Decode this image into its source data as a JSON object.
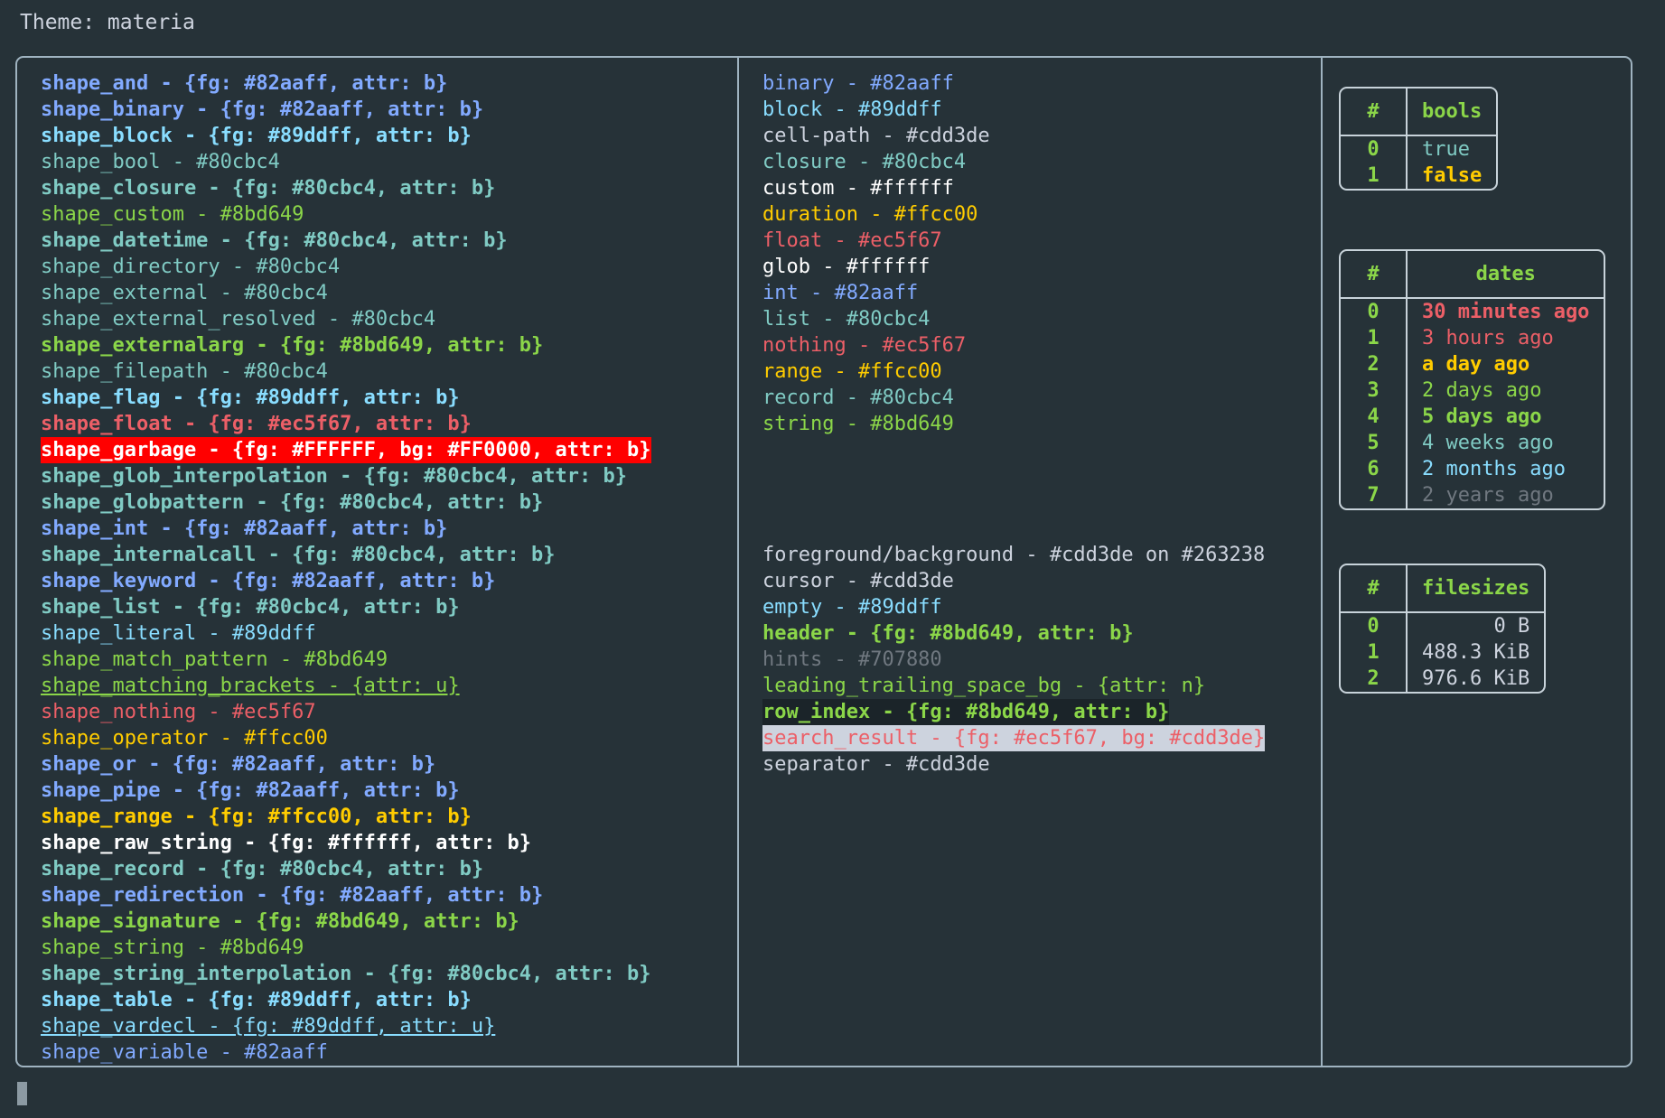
{
  "header": {
    "title": "Theme: materia"
  },
  "palette": {
    "blue": "#82aaff",
    "cyan": "#89ddff",
    "teal": "#80cbc4",
    "green": "#8bd649",
    "red": "#ec5f67",
    "yellow": "#ffcc00",
    "white": "#ffffff",
    "fg": "#cdd3de",
    "hint": "#707880",
    "bg": "#263238",
    "garbage_bg": "#ff0000",
    "garbage_fg": "#ffffff",
    "search_bg": "#cdd3de",
    "rowindex_bg": "#1b2429"
  },
  "shapes": [
    {
      "text": "shape_and - {fg: #82aaff, attr: b}",
      "color": "#82aaff",
      "bold": true
    },
    {
      "text": "shape_binary - {fg: #82aaff, attr: b}",
      "color": "#82aaff",
      "bold": true
    },
    {
      "text": "shape_block - {fg: #89ddff, attr: b}",
      "color": "#89ddff",
      "bold": true
    },
    {
      "text": "shape_bool - #80cbc4",
      "color": "#80cbc4",
      "bold": false
    },
    {
      "text": "shape_closure - {fg: #80cbc4, attr: b}",
      "color": "#80cbc4",
      "bold": true
    },
    {
      "text": "shape_custom - #8bd649",
      "color": "#8bd649",
      "bold": false
    },
    {
      "text": "shape_datetime - {fg: #80cbc4, attr: b}",
      "color": "#80cbc4",
      "bold": true
    },
    {
      "text": "shape_directory - #80cbc4",
      "color": "#80cbc4",
      "bold": false
    },
    {
      "text": "shape_external - #80cbc4",
      "color": "#80cbc4",
      "bold": false
    },
    {
      "text": "shape_external_resolved - #80cbc4",
      "color": "#80cbc4",
      "bold": false
    },
    {
      "text": "shape_externalarg - {fg: #8bd649, attr: b}",
      "color": "#8bd649",
      "bold": true
    },
    {
      "text": "shape_filepath - #80cbc4",
      "color": "#80cbc4",
      "bold": false
    },
    {
      "text": "shape_flag - {fg: #89ddff, attr: b}",
      "color": "#89ddff",
      "bold": true
    },
    {
      "text": "shape_float - {fg: #ec5f67, attr: b}",
      "color": "#ec5f67",
      "bold": true
    },
    {
      "text": "shape_garbage - {fg: #FFFFFF, bg: #FF0000, attr: b}",
      "color": "#ffffff",
      "bg": "#ff0000",
      "bold": true
    },
    {
      "text": "shape_glob_interpolation - {fg: #80cbc4, attr: b}",
      "color": "#80cbc4",
      "bold": true
    },
    {
      "text": "shape_globpattern - {fg: #80cbc4, attr: b}",
      "color": "#80cbc4",
      "bold": true
    },
    {
      "text": "shape_int - {fg: #82aaff, attr: b}",
      "color": "#82aaff",
      "bold": true
    },
    {
      "text": "shape_internalcall - {fg: #80cbc4, attr: b}",
      "color": "#80cbc4",
      "bold": true
    },
    {
      "text": "shape_keyword - {fg: #82aaff, attr: b}",
      "color": "#82aaff",
      "bold": true
    },
    {
      "text": "shape_list - {fg: #80cbc4, attr: b}",
      "color": "#80cbc4",
      "bold": true
    },
    {
      "text": "shape_literal - #89ddff",
      "color": "#89ddff",
      "bold": false
    },
    {
      "text": "shape_match_pattern - #8bd649",
      "color": "#8bd649",
      "bold": false
    },
    {
      "text": "shape_matching_brackets - {attr: u}",
      "color": "#8bd649",
      "bold": false,
      "underline": true
    },
    {
      "text": "shape_nothing - #ec5f67",
      "color": "#ec5f67",
      "bold": false
    },
    {
      "text": "shape_operator - #ffcc00",
      "color": "#ffcc00",
      "bold": false
    },
    {
      "text": "shape_or - {fg: #82aaff, attr: b}",
      "color": "#82aaff",
      "bold": true
    },
    {
      "text": "shape_pipe - {fg: #82aaff, attr: b}",
      "color": "#82aaff",
      "bold": true
    },
    {
      "text": "shape_range - {fg: #ffcc00, attr: b}",
      "color": "#ffcc00",
      "bold": true
    },
    {
      "text": "shape_raw_string - {fg: #ffffff, attr: b}",
      "color": "#ffffff",
      "bold": true
    },
    {
      "text": "shape_record - {fg: #80cbc4, attr: b}",
      "color": "#80cbc4",
      "bold": true
    },
    {
      "text": "shape_redirection - {fg: #82aaff, attr: b}",
      "color": "#82aaff",
      "bold": true
    },
    {
      "text": "shape_signature - {fg: #8bd649, attr: b}",
      "color": "#8bd649",
      "bold": true
    },
    {
      "text": "shape_string - #8bd649",
      "color": "#8bd649",
      "bold": false
    },
    {
      "text": "shape_string_interpolation - {fg: #80cbc4, attr: b}",
      "color": "#80cbc4",
      "bold": true
    },
    {
      "text": "shape_table - {fg: #89ddff, attr: b}",
      "color": "#89ddff",
      "bold": true
    },
    {
      "text": "shape_vardecl - {fg: #89ddff, attr: u}",
      "color": "#89ddff",
      "bold": false,
      "underline": true
    },
    {
      "text": "shape_variable - #82aaff",
      "color": "#82aaff",
      "bold": false
    }
  ],
  "types": [
    {
      "text": "binary - #82aaff",
      "color": "#82aaff",
      "bold": false
    },
    {
      "text": "block - #89ddff",
      "color": "#89ddff",
      "bold": false
    },
    {
      "text": "cell-path - #cdd3de",
      "color": "#cdd3de",
      "bold": false
    },
    {
      "text": "closure - #80cbc4",
      "color": "#80cbc4",
      "bold": false
    },
    {
      "text": "custom - #ffffff",
      "color": "#ffffff",
      "bold": false
    },
    {
      "text": "duration - #ffcc00",
      "color": "#ffcc00",
      "bold": false
    },
    {
      "text": "float - #ec5f67",
      "color": "#ec5f67",
      "bold": false
    },
    {
      "text": "glob - #ffffff",
      "color": "#ffffff",
      "bold": false
    },
    {
      "text": "int - #82aaff",
      "color": "#82aaff",
      "bold": false
    },
    {
      "text": "list - #80cbc4",
      "color": "#80cbc4",
      "bold": false
    },
    {
      "text": "nothing - #ec5f67",
      "color": "#ec5f67",
      "bold": false
    },
    {
      "text": "range - #ffcc00",
      "color": "#ffcc00",
      "bold": false
    },
    {
      "text": "record - #80cbc4",
      "color": "#80cbc4",
      "bold": false
    },
    {
      "text": "string - #8bd649",
      "color": "#8bd649",
      "bold": false
    }
  ],
  "ui_elements": [
    {
      "text": "foreground/background - #cdd3de on #263238",
      "color": "#cdd3de",
      "bold": false
    },
    {
      "text": "cursor - #cdd3de",
      "color": "#cdd3de",
      "bold": false
    },
    {
      "text": "empty - #89ddff",
      "color": "#89ddff",
      "bold": false
    },
    {
      "text": "header - {fg: #8bd649, attr: b}",
      "color": "#8bd649",
      "bold": true
    },
    {
      "text": "hints - #707880",
      "color": "#707880",
      "bold": false
    },
    {
      "text": "leading_trailing_space_bg - {attr: n}",
      "color": "#8bd649",
      "bold": false
    },
    {
      "text": "row_index - {fg: #8bd649, attr: b}",
      "color": "#8bd649",
      "bold": true,
      "bg": "#1b2429"
    },
    {
      "text": "search_result - {fg: #ec5f67, bg: #cdd3de}",
      "color": "#ec5f67",
      "bold": false,
      "bg": "#cdd3de"
    },
    {
      "text": "separator - #cdd3de",
      "color": "#cdd3de",
      "bold": false
    }
  ],
  "tables": {
    "bools": {
      "columns": [
        "#",
        "bools"
      ],
      "rows": [
        {
          "index": "0",
          "value": "true",
          "color": "#80cbc4",
          "bold": false
        },
        {
          "index": "1",
          "value": "false",
          "color": "#ffcc00",
          "bold": true
        }
      ]
    },
    "dates": {
      "columns": [
        "#",
        "dates"
      ],
      "rows": [
        {
          "index": "0",
          "value": "30 minutes ago",
          "color": "#ec5f67",
          "bold": true
        },
        {
          "index": "1",
          "value": "3 hours ago",
          "color": "#ec5f67",
          "bold": false
        },
        {
          "index": "2",
          "value": "a day ago",
          "color": "#ffcc00",
          "bold": true
        },
        {
          "index": "3",
          "value": "2 days ago",
          "color": "#8bd649",
          "bold": false
        },
        {
          "index": "4",
          "value": "5 days ago",
          "color": "#8bd649",
          "bold": true
        },
        {
          "index": "5",
          "value": "4 weeks ago",
          "color": "#80cbc4",
          "bold": false
        },
        {
          "index": "6",
          "value": "2 months ago",
          "color": "#89ddff",
          "bold": false
        },
        {
          "index": "7",
          "value": "2 years ago",
          "color": "#707880",
          "bold": false
        }
      ]
    },
    "filesizes": {
      "columns": [
        "#",
        "filesizes"
      ],
      "rows": [
        {
          "index": "0",
          "value": "0 B",
          "color": "#cdd3de",
          "bold": false
        },
        {
          "index": "1",
          "value": "488.3 KiB",
          "color": "#cdd3de",
          "bold": false
        },
        {
          "index": "2",
          "value": "976.6 KiB",
          "color": "#cdd3de",
          "bold": false
        }
      ]
    }
  },
  "prompt": {
    "cursor": "block-cursor"
  }
}
